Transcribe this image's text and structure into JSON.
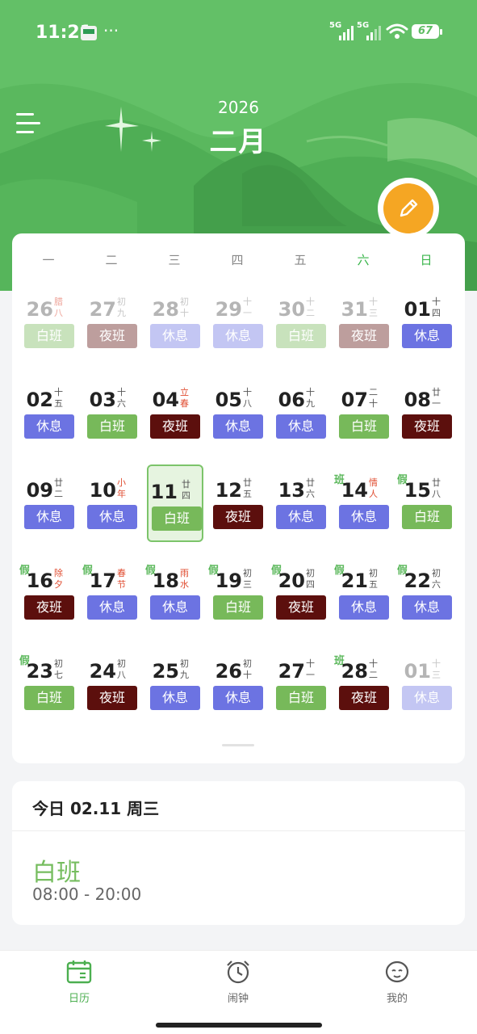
{
  "status_bar": {
    "time": "11:21",
    "overflow": "···",
    "signal1": "5G",
    "signal2": "5G",
    "battery": "67"
  },
  "header": {
    "year": "2026",
    "month": "二月"
  },
  "weekdays": [
    "一",
    "二",
    "三",
    "四",
    "五",
    "六",
    "日"
  ],
  "shift_colors": {
    "白班": "#77b95a",
    "夜班": "#5c0f0d",
    "休息": "#6c73e2"
  },
  "days": [
    {
      "day": "26",
      "lunar": "腊八",
      "shift": "白班",
      "faded": true,
      "red": true
    },
    {
      "day": "27",
      "lunar": "初九",
      "shift": "夜班",
      "faded": true
    },
    {
      "day": "28",
      "lunar": "初十",
      "shift": "休息",
      "faded": true
    },
    {
      "day": "29",
      "lunar": "十一",
      "shift": "休息",
      "faded": true
    },
    {
      "day": "30",
      "lunar": "十二",
      "shift": "白班",
      "faded": true
    },
    {
      "day": "31",
      "lunar": "十三",
      "shift": "夜班",
      "faded": true
    },
    {
      "day": "01",
      "lunar": "十四",
      "shift": "休息"
    },
    {
      "day": "02",
      "lunar": "十五",
      "shift": "休息"
    },
    {
      "day": "03",
      "lunar": "十六",
      "shift": "白班"
    },
    {
      "day": "04",
      "lunar": "立春",
      "shift": "夜班",
      "red": true
    },
    {
      "day": "05",
      "lunar": "十八",
      "shift": "休息"
    },
    {
      "day": "06",
      "lunar": "十九",
      "shift": "休息"
    },
    {
      "day": "07",
      "lunar": "二十",
      "shift": "白班"
    },
    {
      "day": "08",
      "lunar": "廿一",
      "shift": "夜班"
    },
    {
      "day": "09",
      "lunar": "廿二",
      "shift": "休息"
    },
    {
      "day": "10",
      "lunar": "小年",
      "shift": "休息",
      "red": true
    },
    {
      "day": "11",
      "lunar": "廿四",
      "shift": "白班",
      "today": true
    },
    {
      "day": "12",
      "lunar": "廿五",
      "shift": "夜班"
    },
    {
      "day": "13",
      "lunar": "廿六",
      "shift": "休息"
    },
    {
      "day": "14",
      "lunar": "情人",
      "shift": "休息",
      "red": true,
      "tag": "班"
    },
    {
      "day": "15",
      "lunar": "廿八",
      "shift": "白班",
      "tag": "假"
    },
    {
      "day": "16",
      "lunar": "除夕",
      "shift": "夜班",
      "red": true,
      "tag": "假"
    },
    {
      "day": "17",
      "lunar": "春节",
      "shift": "休息",
      "red": true,
      "tag": "假"
    },
    {
      "day": "18",
      "lunar": "雨水",
      "shift": "休息",
      "red": true,
      "tag": "假"
    },
    {
      "day": "19",
      "lunar": "初三",
      "shift": "白班",
      "tag": "假"
    },
    {
      "day": "20",
      "lunar": "初四",
      "shift": "夜班",
      "tag": "假"
    },
    {
      "day": "21",
      "lunar": "初五",
      "shift": "休息",
      "tag": "假"
    },
    {
      "day": "22",
      "lunar": "初六",
      "shift": "休息",
      "tag": "假"
    },
    {
      "day": "23",
      "lunar": "初七",
      "shift": "白班",
      "tag": "假"
    },
    {
      "day": "24",
      "lunar": "初八",
      "shift": "夜班"
    },
    {
      "day": "25",
      "lunar": "初九",
      "shift": "休息"
    },
    {
      "day": "26",
      "lunar": "初十",
      "shift": "休息"
    },
    {
      "day": "27",
      "lunar": "十一",
      "shift": "白班"
    },
    {
      "day": "28",
      "lunar": "十二",
      "shift": "夜班",
      "tag": "班"
    },
    {
      "day": "01",
      "lunar": "十三",
      "shift": "休息",
      "faded": true
    }
  ],
  "today_card": {
    "title": "今日 02.11 周三",
    "shift_name": "白班",
    "shift_time": "08:00 - 20:00"
  },
  "nav": [
    {
      "label": "日历",
      "icon": "calendar-icon",
      "active": true
    },
    {
      "label": "闹钟",
      "icon": "alarm-clock-icon"
    },
    {
      "label": "我的",
      "icon": "profile-icon"
    }
  ]
}
